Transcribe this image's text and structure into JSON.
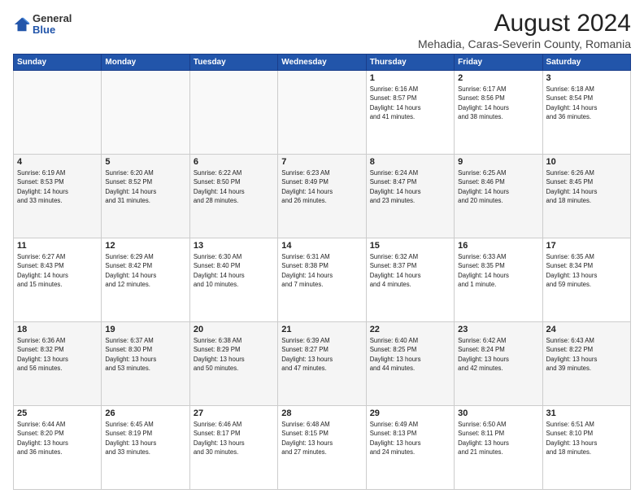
{
  "logo": {
    "general": "General",
    "blue": "Blue"
  },
  "title": "August 2024",
  "subtitle": "Mehadia, Caras-Severin County, Romania",
  "headers": [
    "Sunday",
    "Monday",
    "Tuesday",
    "Wednesday",
    "Thursday",
    "Friday",
    "Saturday"
  ],
  "weeks": [
    [
      {
        "day": "",
        "info": ""
      },
      {
        "day": "",
        "info": ""
      },
      {
        "day": "",
        "info": ""
      },
      {
        "day": "",
        "info": ""
      },
      {
        "day": "1",
        "info": "Sunrise: 6:16 AM\nSunset: 8:57 PM\nDaylight: 14 hours\nand 41 minutes."
      },
      {
        "day": "2",
        "info": "Sunrise: 6:17 AM\nSunset: 8:56 PM\nDaylight: 14 hours\nand 38 minutes."
      },
      {
        "day": "3",
        "info": "Sunrise: 6:18 AM\nSunset: 8:54 PM\nDaylight: 14 hours\nand 36 minutes."
      }
    ],
    [
      {
        "day": "4",
        "info": "Sunrise: 6:19 AM\nSunset: 8:53 PM\nDaylight: 14 hours\nand 33 minutes."
      },
      {
        "day": "5",
        "info": "Sunrise: 6:20 AM\nSunset: 8:52 PM\nDaylight: 14 hours\nand 31 minutes."
      },
      {
        "day": "6",
        "info": "Sunrise: 6:22 AM\nSunset: 8:50 PM\nDaylight: 14 hours\nand 28 minutes."
      },
      {
        "day": "7",
        "info": "Sunrise: 6:23 AM\nSunset: 8:49 PM\nDaylight: 14 hours\nand 26 minutes."
      },
      {
        "day": "8",
        "info": "Sunrise: 6:24 AM\nSunset: 8:47 PM\nDaylight: 14 hours\nand 23 minutes."
      },
      {
        "day": "9",
        "info": "Sunrise: 6:25 AM\nSunset: 8:46 PM\nDaylight: 14 hours\nand 20 minutes."
      },
      {
        "day": "10",
        "info": "Sunrise: 6:26 AM\nSunset: 8:45 PM\nDaylight: 14 hours\nand 18 minutes."
      }
    ],
    [
      {
        "day": "11",
        "info": "Sunrise: 6:27 AM\nSunset: 8:43 PM\nDaylight: 14 hours\nand 15 minutes."
      },
      {
        "day": "12",
        "info": "Sunrise: 6:29 AM\nSunset: 8:42 PM\nDaylight: 14 hours\nand 12 minutes."
      },
      {
        "day": "13",
        "info": "Sunrise: 6:30 AM\nSunset: 8:40 PM\nDaylight: 14 hours\nand 10 minutes."
      },
      {
        "day": "14",
        "info": "Sunrise: 6:31 AM\nSunset: 8:38 PM\nDaylight: 14 hours\nand 7 minutes."
      },
      {
        "day": "15",
        "info": "Sunrise: 6:32 AM\nSunset: 8:37 PM\nDaylight: 14 hours\nand 4 minutes."
      },
      {
        "day": "16",
        "info": "Sunrise: 6:33 AM\nSunset: 8:35 PM\nDaylight: 14 hours\nand 1 minute."
      },
      {
        "day": "17",
        "info": "Sunrise: 6:35 AM\nSunset: 8:34 PM\nDaylight: 13 hours\nand 59 minutes."
      }
    ],
    [
      {
        "day": "18",
        "info": "Sunrise: 6:36 AM\nSunset: 8:32 PM\nDaylight: 13 hours\nand 56 minutes."
      },
      {
        "day": "19",
        "info": "Sunrise: 6:37 AM\nSunset: 8:30 PM\nDaylight: 13 hours\nand 53 minutes."
      },
      {
        "day": "20",
        "info": "Sunrise: 6:38 AM\nSunset: 8:29 PM\nDaylight: 13 hours\nand 50 minutes."
      },
      {
        "day": "21",
        "info": "Sunrise: 6:39 AM\nSunset: 8:27 PM\nDaylight: 13 hours\nand 47 minutes."
      },
      {
        "day": "22",
        "info": "Sunrise: 6:40 AM\nSunset: 8:25 PM\nDaylight: 13 hours\nand 44 minutes."
      },
      {
        "day": "23",
        "info": "Sunrise: 6:42 AM\nSunset: 8:24 PM\nDaylight: 13 hours\nand 42 minutes."
      },
      {
        "day": "24",
        "info": "Sunrise: 6:43 AM\nSunset: 8:22 PM\nDaylight: 13 hours\nand 39 minutes."
      }
    ],
    [
      {
        "day": "25",
        "info": "Sunrise: 6:44 AM\nSunset: 8:20 PM\nDaylight: 13 hours\nand 36 minutes."
      },
      {
        "day": "26",
        "info": "Sunrise: 6:45 AM\nSunset: 8:19 PM\nDaylight: 13 hours\nand 33 minutes."
      },
      {
        "day": "27",
        "info": "Sunrise: 6:46 AM\nSunset: 8:17 PM\nDaylight: 13 hours\nand 30 minutes."
      },
      {
        "day": "28",
        "info": "Sunrise: 6:48 AM\nSunset: 8:15 PM\nDaylight: 13 hours\nand 27 minutes."
      },
      {
        "day": "29",
        "info": "Sunrise: 6:49 AM\nSunset: 8:13 PM\nDaylight: 13 hours\nand 24 minutes."
      },
      {
        "day": "30",
        "info": "Sunrise: 6:50 AM\nSunset: 8:11 PM\nDaylight: 13 hours\nand 21 minutes."
      },
      {
        "day": "31",
        "info": "Sunrise: 6:51 AM\nSunset: 8:10 PM\nDaylight: 13 hours\nand 18 minutes."
      }
    ]
  ]
}
